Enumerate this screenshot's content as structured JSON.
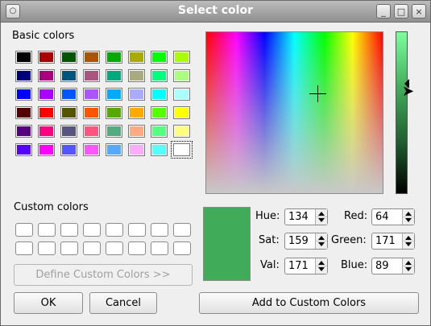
{
  "window": {
    "title": "Select color",
    "buttons": {
      "menu_icon": "circle-icon",
      "minimize": "_",
      "maximize": "□",
      "close": "×"
    }
  },
  "basic_colors": {
    "label": "Basic colors",
    "rows": [
      [
        "#000000",
        "#aa0000",
        "#005500",
        "#aa5500",
        "#00aa00",
        "#aaaa00",
        "#00ff00",
        "#aaff00"
      ],
      [
        "#00007f",
        "#aa007f",
        "#00557f",
        "#aa557f",
        "#00aa7f",
        "#aaaa7f",
        "#00ff7f",
        "#aaff7f"
      ],
      [
        "#0000ff",
        "#aa00ff",
        "#0055ff",
        "#aa55ff",
        "#00aaff",
        "#aaaaff",
        "#00ffff",
        "#aaffff"
      ],
      [
        "#550000",
        "#ff0000",
        "#555500",
        "#ff5500",
        "#55aa00",
        "#ffaa00",
        "#55ff00",
        "#ffff00"
      ],
      [
        "#55007f",
        "#ff007f",
        "#55557f",
        "#ff557f",
        "#55aa7f",
        "#ffaa7f",
        "#55ff7f",
        "#ffff7f"
      ],
      [
        "#5500ff",
        "#ff00ff",
        "#5555ff",
        "#ff55ff",
        "#55aaff",
        "#ffaaff",
        "#55ffff",
        "#ffffff"
      ]
    ],
    "selected": "#ffffff"
  },
  "custom_colors": {
    "label": "Custom colors"
  },
  "define_button": "Define Custom Colors >>",
  "ok_button": "OK",
  "cancel_button": "Cancel",
  "add_button": "Add to Custom Colors",
  "current_color": "#40ab59",
  "fields": {
    "hue": {
      "label": "Hue:",
      "value": "134"
    },
    "sat": {
      "label": "Sat:",
      "value": "159"
    },
    "val": {
      "label": "Val:",
      "value": "171"
    },
    "red": {
      "label": "Red:",
      "value": "64"
    },
    "green": {
      "label": "Green:",
      "value": "171"
    },
    "blue": {
      "label": "Blue:",
      "value": "89"
    }
  }
}
